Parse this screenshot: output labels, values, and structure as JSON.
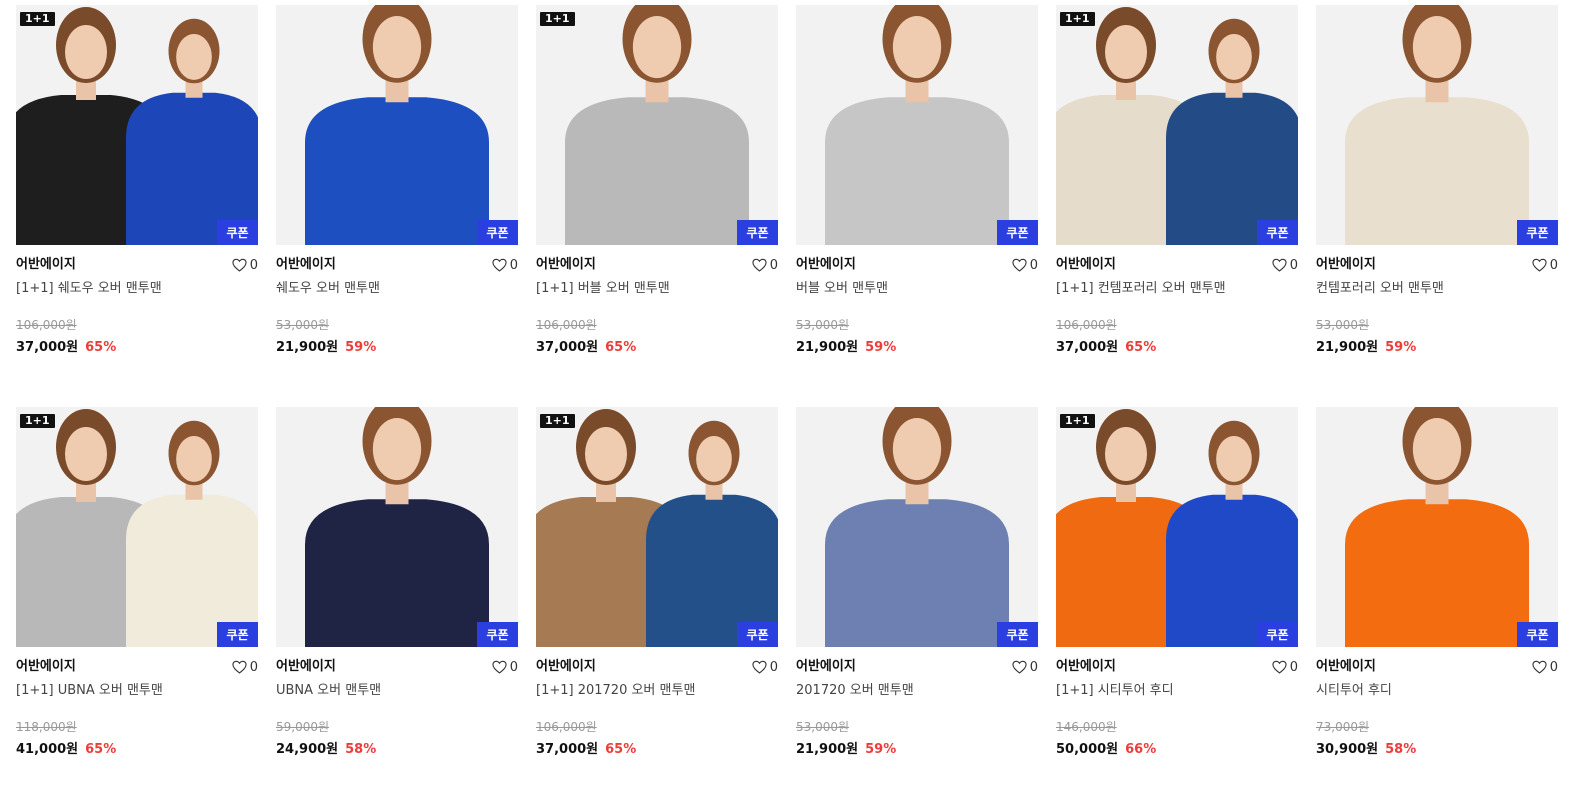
{
  "coupon_label": "쿠폰",
  "bundle_label": "1+1",
  "colors": {
    "coupon_bg": "#2b3fe0",
    "discount": "#f03b3b"
  },
  "products": [
    {
      "brand": "어반에이지",
      "name": "[1+1] 쉐도우 오버 맨투맨",
      "likes": "0",
      "original_price": "106,000원",
      "price": "37,000원",
      "discount": "65%",
      "bundle": true,
      "image_colors": [
        "#1e1e1e",
        "#1d47b9"
      ]
    },
    {
      "brand": "어반에이지",
      "name": "쉐도우 오버 맨투맨",
      "likes": "0",
      "original_price": "53,000원",
      "price": "21,900원",
      "discount": "59%",
      "bundle": false,
      "image_colors": [
        "#1d4fc0"
      ]
    },
    {
      "brand": "어반에이지",
      "name": "[1+1] 버블 오버 맨투맨",
      "likes": "0",
      "original_price": "106,000원",
      "price": "37,000원",
      "discount": "65%",
      "bundle": true,
      "image_colors": [
        "#b9b9b9"
      ]
    },
    {
      "brand": "어반에이지",
      "name": "버블 오버 맨투맨",
      "likes": "0",
      "original_price": "53,000원",
      "price": "21,900원",
      "discount": "59%",
      "bundle": false,
      "image_colors": [
        "#c6c6c6"
      ]
    },
    {
      "brand": "어반에이지",
      "name": "[1+1] 컨템포러리 오버 맨투맨",
      "likes": "0",
      "original_price": "106,000원",
      "price": "37,000원",
      "discount": "65%",
      "bundle": true,
      "image_colors": [
        "#e6dccb",
        "#234c86"
      ]
    },
    {
      "brand": "어반에이지",
      "name": "컨템포러리 오버 맨투맨",
      "likes": "0",
      "original_price": "53,000원",
      "price": "21,900원",
      "discount": "59%",
      "bundle": false,
      "image_colors": [
        "#e8dfcf"
      ]
    },
    {
      "brand": "어반에이지",
      "name": "[1+1] UBNA 오버 맨투맨",
      "likes": "0",
      "original_price": "118,000원",
      "price": "41,000원",
      "discount": "65%",
      "bundle": true,
      "image_colors": [
        "#b8b8b8",
        "#f1ebdc"
      ]
    },
    {
      "brand": "어반에이지",
      "name": "UBNA 오버 맨투맨",
      "likes": "0",
      "original_price": "59,000원",
      "price": "24,900원",
      "discount": "58%",
      "bundle": false,
      "image_colors": [
        "#1f2444"
      ]
    },
    {
      "brand": "어반에이지",
      "name": "[1+1] 201720 오버 맨투맨",
      "likes": "0",
      "original_price": "106,000원",
      "price": "37,000원",
      "discount": "65%",
      "bundle": true,
      "image_colors": [
        "#a67a52",
        "#24508a"
      ]
    },
    {
      "brand": "어반에이지",
      "name": "201720 오버 맨투맨",
      "likes": "0",
      "original_price": "53,000원",
      "price": "21,900원",
      "discount": "59%",
      "bundle": false,
      "image_colors": [
        "#6e7fb1"
      ]
    },
    {
      "brand": "어반에이지",
      "name": "[1+1] 시티투어 후디",
      "likes": "0",
      "original_price": "146,000원",
      "price": "50,000원",
      "discount": "66%",
      "bundle": true,
      "image_colors": [
        "#f06a12",
        "#1f49c6"
      ]
    },
    {
      "brand": "어반에이지",
      "name": "시티투어 후디",
      "likes": "0",
      "original_price": "73,000원",
      "price": "30,900원",
      "discount": "58%",
      "bundle": false,
      "image_colors": [
        "#f36d10"
      ]
    }
  ]
}
